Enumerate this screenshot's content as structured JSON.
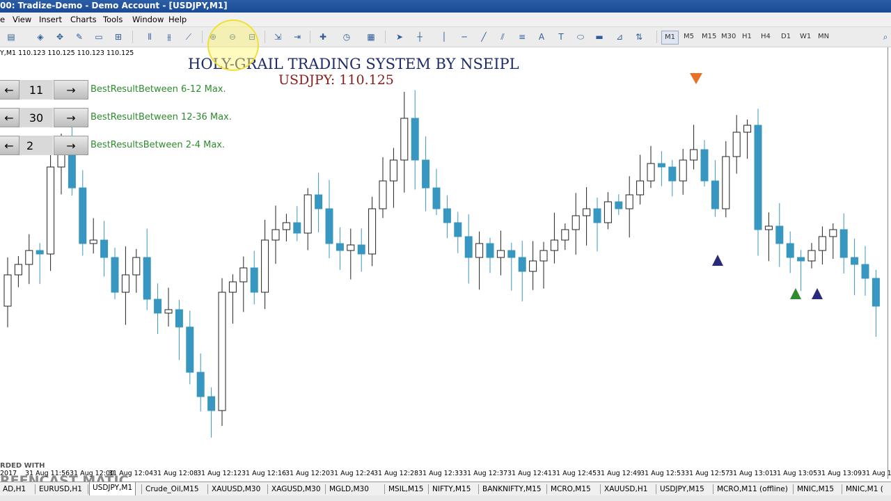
{
  "window": {
    "title": "00: Tradize-Demo - Demo Account - [USDJPY,M1]"
  },
  "menu": [
    "e",
    "View",
    "Insert",
    "Charts",
    "Tools",
    "Window",
    "Help"
  ],
  "timeframes": [
    "M1",
    "M5",
    "M15",
    "M30",
    "H1",
    "H4",
    "D1",
    "W1",
    "MN"
  ],
  "active_timeframe": "M1",
  "chart": {
    "symbol_line": "Y,M1  110.123 110.125 110.123 110.125",
    "title": "HOLY-GRAIL TRADING SYSTEM BY NSEIPL",
    "price_line": "USDJPY: 110.125",
    "colors": {
      "bull": "#ffffff",
      "bear": "#3797c0",
      "wick": "#222222",
      "title": "#1d2a6b",
      "price": "#8b1c1c"
    }
  },
  "panel": [
    {
      "value": "11",
      "label": "BestResultBetween 6-12 Max."
    },
    {
      "value": "30",
      "label": "BestResultBetween 12-36 Max."
    },
    {
      "value": "2",
      "label": "BestResultsBetween 2-4 Max."
    }
  ],
  "time_labels": [
    "2017",
    "31 Aug 11:56",
    "31 Aug 12:00",
    "31 Aug 12:04",
    "31 Aug 12:08",
    "31 Aug 12:12",
    "31 Aug 12:16",
    "31 Aug 12:20",
    "31 Aug 12:24",
    "31 Aug 12:28",
    "31 Aug 12:33",
    "31 Aug 12:37",
    "31 Aug 12:41",
    "31 Aug 12:45",
    "31 Aug 12:49",
    "31 Aug 12:53",
    "31 Aug 12:57",
    "31 Aug 13:01",
    "31 Aug 13:05",
    "31 Aug 13:09",
    "31 Aug 13"
  ],
  "tabs": [
    "AD,H1",
    "EURUSD,H1",
    "USDJPY,M1",
    "Crude_Oil,M15",
    "XAUUSD,M30",
    "XAGUSD,M30",
    "MGLD,M30",
    "MSIL,M15",
    "NIFTY,M15",
    "BANKNIFTY,M15",
    "MCRO,M15",
    "XAUUSD,H1",
    "USDJPY,M15",
    "MCRO,M11 (offline)",
    "MNIC,M15",
    "MNIC,M1 ("
  ],
  "active_tab": "USDJPY,M1",
  "watermark": {
    "top": "RDED WITH",
    "main": "REENCAST  MATIC"
  }
}
